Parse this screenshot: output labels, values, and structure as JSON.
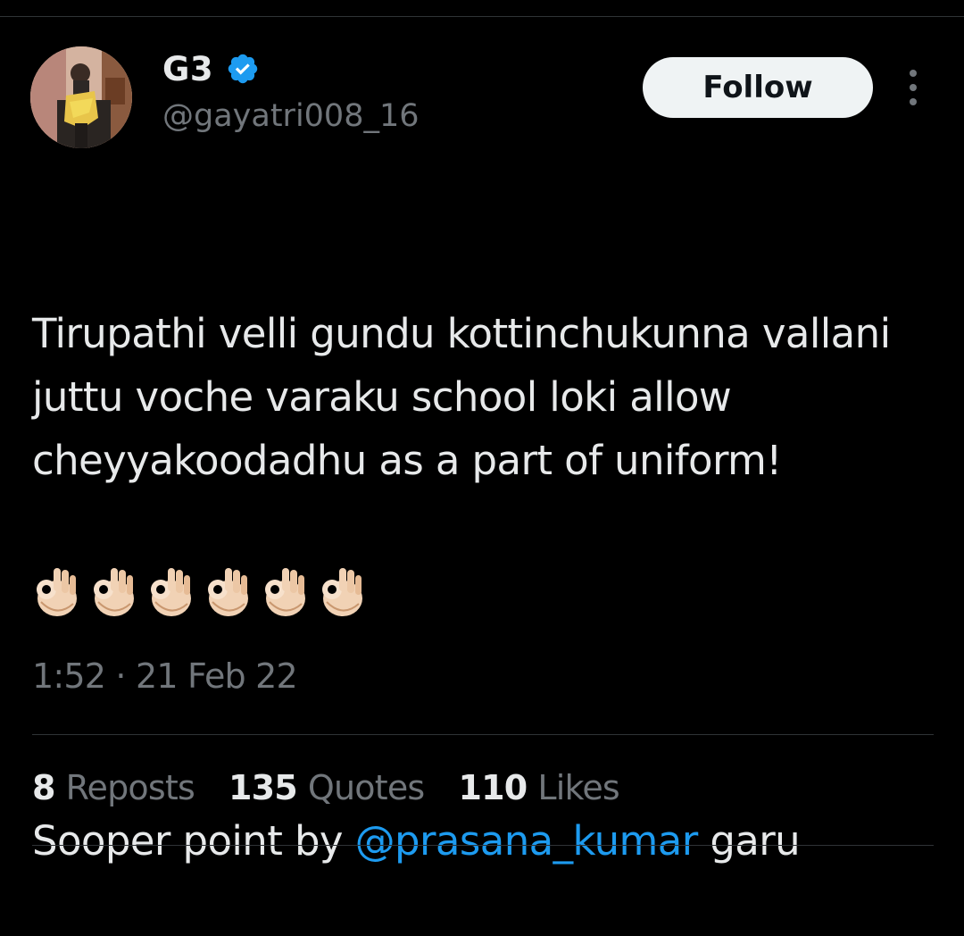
{
  "author": {
    "display_name": "G3",
    "handle": "@gayatri008_16",
    "verified": true
  },
  "follow_label": "Follow",
  "tweet": {
    "paragraph1": "Tirupathi velli gundu kottinchukunna vallani juttu voche varaku school loki allow cheyyakoodadhu as a part of uniform!",
    "paragraph2_prefix": "Sooper point by ",
    "mention": "@prasana_kumar",
    "paragraph2_suffix": " garu",
    "emojis": [
      "👌🏻",
      "👌🏻",
      "👌🏻",
      "👌🏻",
      "👌🏻",
      "👌🏻"
    ]
  },
  "timestamp": "1:52 · 21 Feb 22",
  "stats": {
    "reposts": {
      "count": "8",
      "label": "Reposts"
    },
    "quotes": {
      "count": "135",
      "label": "Quotes"
    },
    "likes": {
      "count": "110",
      "label": "Likes"
    }
  },
  "colors": {
    "background": "#000000",
    "text": "#e7e9ea",
    "secondary_text": "#71767b",
    "accent_link": "#1d9bf0",
    "verified_badge": "#1d9bf0",
    "follow_button_bg": "#eff3f4",
    "divider": "#2f3336"
  },
  "icons": {
    "verified": "verified-badge-icon",
    "more": "more-vertical-icon",
    "emoji": "ok-hand-icon"
  }
}
